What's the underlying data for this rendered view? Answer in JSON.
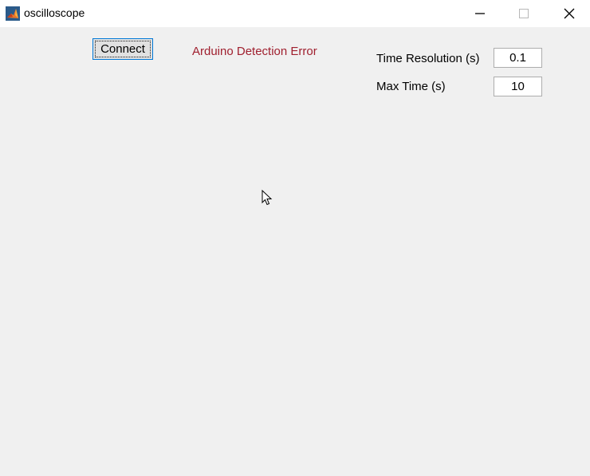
{
  "window": {
    "title": "oscilloscope",
    "icon": "matlab-icon"
  },
  "controls": {
    "connect_label": "Connect",
    "status_text": "Arduino Detection Error",
    "status_color": "#a0202f"
  },
  "fields": [
    {
      "label": "Time Resolution (s)",
      "value": "0.1"
    },
    {
      "label": "Max Time (s)",
      "value": "10"
    }
  ]
}
